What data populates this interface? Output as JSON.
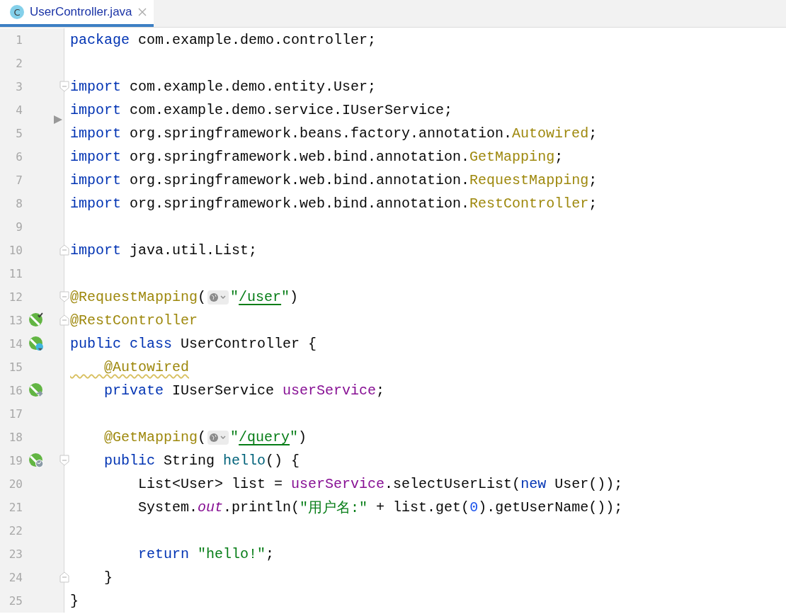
{
  "tab": {
    "icon_letter": "C",
    "title": "UserController.java",
    "selected": true
  },
  "lines": [
    {
      "number": "1",
      "tokens": [
        {
          "kind": "keyword",
          "text": "package"
        },
        {
          "kind": "plain",
          "text": " com.example.demo.controller;"
        }
      ]
    },
    {
      "number": "2"
    },
    {
      "number": "3",
      "fold": {
        "kind": "start"
      },
      "tokens": [
        {
          "kind": "keyword",
          "text": "import"
        },
        {
          "kind": "plain",
          "text": " com.example.demo.entity.User;"
        }
      ]
    },
    {
      "number": "4",
      "tokens": [
        {
          "kind": "keyword",
          "text": "import"
        },
        {
          "kind": "plain",
          "text": " com.example.demo.service.IUserService;"
        }
      ]
    },
    {
      "number": "5",
      "caret": true,
      "tokens": [
        {
          "kind": "keyword",
          "text": "import"
        },
        {
          "kind": "plain",
          "text": " org.springframework.beans.factory.annotation."
        },
        {
          "kind": "annotation",
          "text": "Autowired"
        },
        {
          "kind": "plain",
          "text": ";"
        }
      ]
    },
    {
      "number": "6",
      "tokens": [
        {
          "kind": "keyword",
          "text": "import"
        },
        {
          "kind": "plain",
          "text": " org.springframework.web.bind.annotation."
        },
        {
          "kind": "annotation",
          "text": "GetMapping"
        },
        {
          "kind": "plain",
          "text": ";"
        }
      ]
    },
    {
      "number": "7",
      "tokens": [
        {
          "kind": "keyword",
          "text": "import"
        },
        {
          "kind": "plain",
          "text": " org.springframework.web.bind.annotation."
        },
        {
          "kind": "annotation",
          "text": "RequestMapping"
        },
        {
          "kind": "plain",
          "text": ";"
        }
      ]
    },
    {
      "number": "8",
      "tokens": [
        {
          "kind": "keyword",
          "text": "import"
        },
        {
          "kind": "plain",
          "text": " org.springframework.web.bind.annotation."
        },
        {
          "kind": "annotation",
          "text": "RestController"
        },
        {
          "kind": "plain",
          "text": ";"
        }
      ]
    },
    {
      "number": "9"
    },
    {
      "number": "10",
      "fold": {
        "kind": "end"
      },
      "tokens": [
        {
          "kind": "keyword",
          "text": "import"
        },
        {
          "kind": "plain",
          "text": " java.util.List;"
        }
      ]
    },
    {
      "number": "11"
    },
    {
      "number": "12",
      "fold": {
        "kind": "start"
      },
      "tokens": [
        {
          "kind": "annotation",
          "text": "@RequestMapping"
        },
        {
          "kind": "plain",
          "text": "("
        },
        {
          "kind": "hint"
        },
        {
          "kind": "string",
          "text": "\""
        },
        {
          "kind": "link",
          "text": "/user"
        },
        {
          "kind": "string",
          "text": "\""
        },
        {
          "kind": "plain",
          "text": ")"
        }
      ]
    },
    {
      "number": "13",
      "gutter": {
        "kind": "bean"
      },
      "fold": {
        "kind": "end"
      },
      "tokens": [
        {
          "kind": "annotation",
          "text": "@RestController"
        }
      ]
    },
    {
      "number": "14",
      "gutter": {
        "kind": "bean-class"
      },
      "tokens": [
        {
          "kind": "keyword",
          "text": "public class"
        },
        {
          "kind": "plain",
          "text": " UserController {"
        }
      ]
    },
    {
      "number": "15",
      "tokens": [
        {
          "kind": "annotation",
          "text": "    @Autowired",
          "warning": true
        }
      ]
    },
    {
      "number": "16",
      "gutter": {
        "kind": "bean-inject"
      },
      "tokens": [
        {
          "kind": "keyword",
          "text": "    private"
        },
        {
          "kind": "plain",
          "text": " IUserService "
        },
        {
          "kind": "field",
          "text": "userService"
        },
        {
          "kind": "plain",
          "text": ";"
        }
      ]
    },
    {
      "number": "17"
    },
    {
      "number": "18",
      "tokens": [
        {
          "kind": "annotation",
          "text": "    @GetMapping"
        },
        {
          "kind": "plain",
          "text": "("
        },
        {
          "kind": "hint"
        },
        {
          "kind": "string",
          "text": "\""
        },
        {
          "kind": "link",
          "text": "/query"
        },
        {
          "kind": "string",
          "text": "\""
        },
        {
          "kind": "plain",
          "text": ")"
        }
      ]
    },
    {
      "number": "19",
      "gutter": {
        "kind": "bean-web"
      },
      "fold": {
        "kind": "start"
      },
      "tokens": [
        {
          "kind": "keyword",
          "text": "    public"
        },
        {
          "kind": "plain",
          "text": " String "
        },
        {
          "kind": "method",
          "text": "hello"
        },
        {
          "kind": "plain",
          "text": "() {"
        }
      ]
    },
    {
      "number": "20",
      "tokens": [
        {
          "kind": "plain",
          "text": "        List<User> list = "
        },
        {
          "kind": "field",
          "text": "userService"
        },
        {
          "kind": "plain",
          "text": ".selectUserList("
        },
        {
          "kind": "keyword",
          "text": "new"
        },
        {
          "kind": "plain",
          "text": " User());"
        }
      ]
    },
    {
      "number": "21",
      "tokens": [
        {
          "kind": "plain",
          "text": "        System."
        },
        {
          "kind": "static",
          "text": "out"
        },
        {
          "kind": "plain",
          "text": ".println("
        },
        {
          "kind": "string",
          "text": "\"用户名:\""
        },
        {
          "kind": "plain",
          "text": " + list.get("
        },
        {
          "kind": "number",
          "text": "0"
        },
        {
          "kind": "plain",
          "text": ").getUserName());"
        }
      ]
    },
    {
      "number": "22"
    },
    {
      "number": "23",
      "tokens": [
        {
          "kind": "keyword",
          "text": "        return"
        },
        {
          "kind": "string",
          "text": " \"hello!\""
        },
        {
          "kind": "plain",
          "text": ";"
        }
      ]
    },
    {
      "number": "24",
      "fold": {
        "kind": "end"
      },
      "tokens": [
        {
          "kind": "plain",
          "text": "    }"
        }
      ]
    },
    {
      "number": "25",
      "tokens": [
        {
          "kind": "plain",
          "text": "}"
        }
      ]
    }
  ]
}
